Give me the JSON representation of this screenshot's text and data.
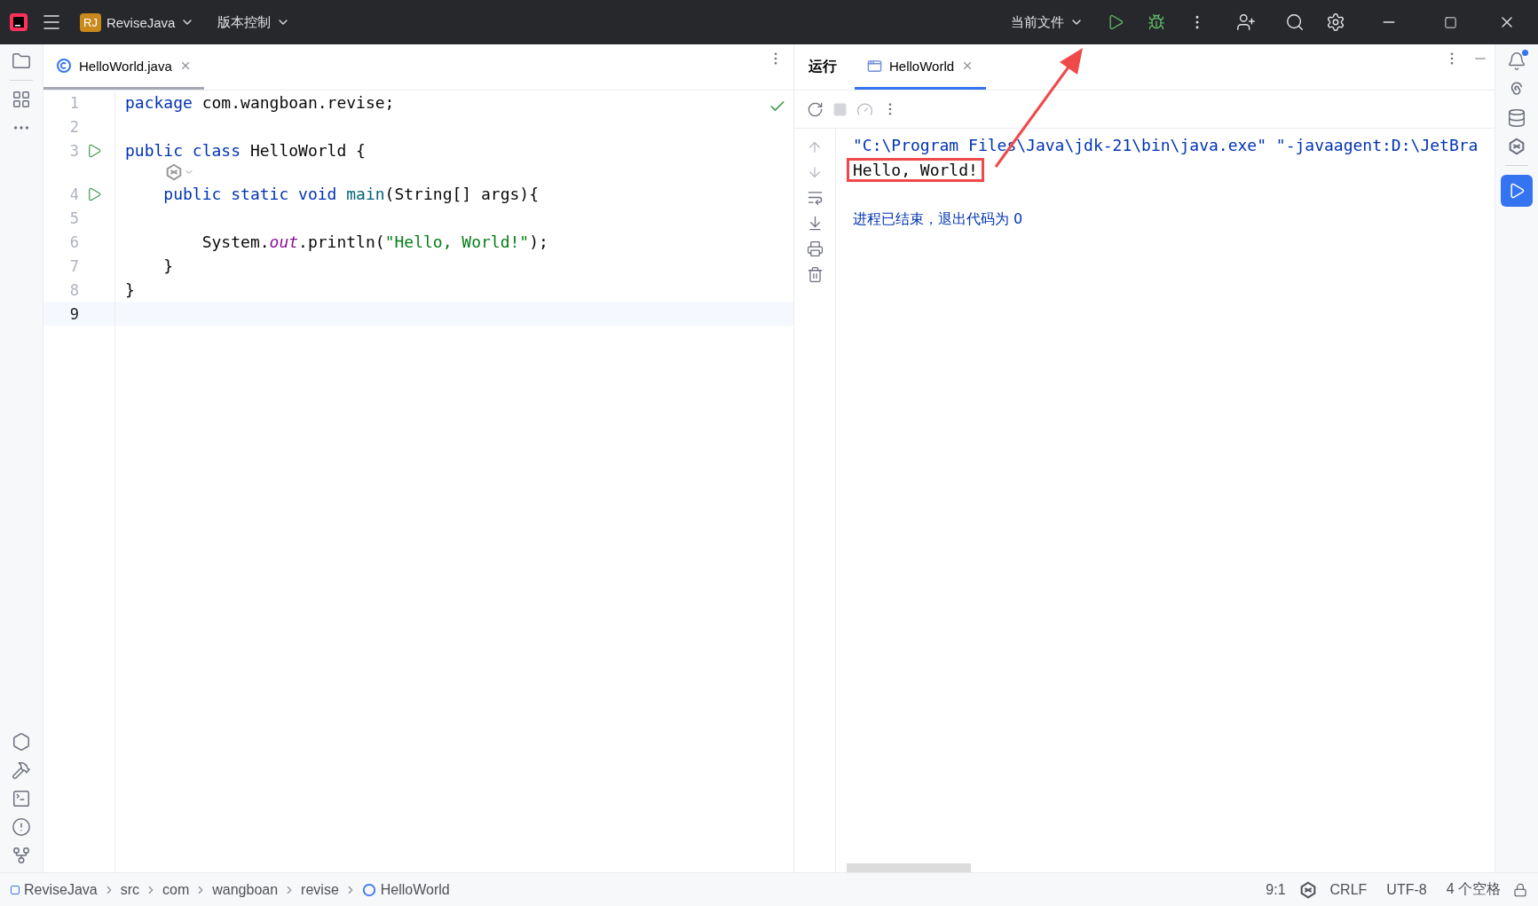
{
  "title_bar": {
    "project_badge": "RJ",
    "project": "ReviseJava",
    "vcs": "版本控制",
    "run_config": "当前文件"
  },
  "editor": {
    "tabs": [
      {
        "label": "HelloWorld.java",
        "selected": true
      }
    ],
    "lines": [
      {
        "kind": "code",
        "number": "1",
        "run": false,
        "current": false,
        "tokens": [
          {
            "kind": "keyword",
            "text": "package"
          },
          {
            "kind": "plain",
            "text": " com.wangboan.revise;"
          }
        ]
      },
      {
        "kind": "code",
        "number": "2",
        "run": false,
        "current": false
      },
      {
        "kind": "code",
        "number": "3",
        "run": true,
        "current": false,
        "tokens": [
          {
            "kind": "keyword",
            "text": "public class"
          },
          {
            "kind": "plain",
            "text": " HelloWorld {"
          }
        ]
      },
      {
        "kind": "hint"
      },
      {
        "kind": "code",
        "number": "4",
        "run": true,
        "current": false,
        "tokens": [
          {
            "kind": "keyword",
            "text": "    public static void"
          },
          {
            "kind": "method",
            "text": " main"
          },
          {
            "kind": "plain",
            "text": "(String[] args){"
          }
        ]
      },
      {
        "kind": "code",
        "number": "5",
        "run": false,
        "current": false
      },
      {
        "kind": "code",
        "number": "6",
        "run": false,
        "current": false,
        "tokens": [
          {
            "kind": "plain",
            "text": "        System."
          },
          {
            "kind": "field",
            "text": "out"
          },
          {
            "kind": "plain",
            "text": ".println("
          },
          {
            "kind": "string",
            "text": "\"Hello, World!\""
          },
          {
            "kind": "plain",
            "text": ");"
          }
        ]
      },
      {
        "kind": "code",
        "number": "7",
        "run": false,
        "current": false,
        "tokens": [
          {
            "kind": "plain",
            "text": "    }"
          }
        ]
      },
      {
        "kind": "code",
        "number": "8",
        "run": false,
        "current": false,
        "tokens": [
          {
            "kind": "plain",
            "text": "}"
          }
        ]
      },
      {
        "kind": "code",
        "number": "9",
        "run": false,
        "current": true
      }
    ]
  },
  "run_panel": {
    "title": "运行",
    "tabs": [
      {
        "label": "HelloWorld",
        "selected": true
      }
    ],
    "console": [
      {
        "kind": "command",
        "text": "\"C:\\Program Files\\Java\\jdk-21\\bin\\java.exe\" \"-javaagent:D:\\JetBra",
        "highlighted": false
      },
      {
        "kind": "output",
        "text": "Hello, World!",
        "highlighted": true
      },
      {
        "kind": "blank"
      },
      {
        "kind": "system",
        "text": "进程已结束，退出代码为 0",
        "highlighted": false
      }
    ]
  },
  "status_bar": {
    "breadcrumbs": [
      {
        "label": "ReviseJava",
        "kind": "module"
      },
      {
        "label": "src",
        "kind": "folder"
      },
      {
        "label": "com",
        "kind": "folder"
      },
      {
        "label": "wangboan",
        "kind": "folder"
      },
      {
        "label": "revise",
        "kind": "folder"
      },
      {
        "label": "HelloWorld",
        "kind": "class"
      }
    ],
    "position": "9:1",
    "line_ending": "CRLF",
    "encoding": "UTF-8",
    "indent": "4 个空格"
  }
}
